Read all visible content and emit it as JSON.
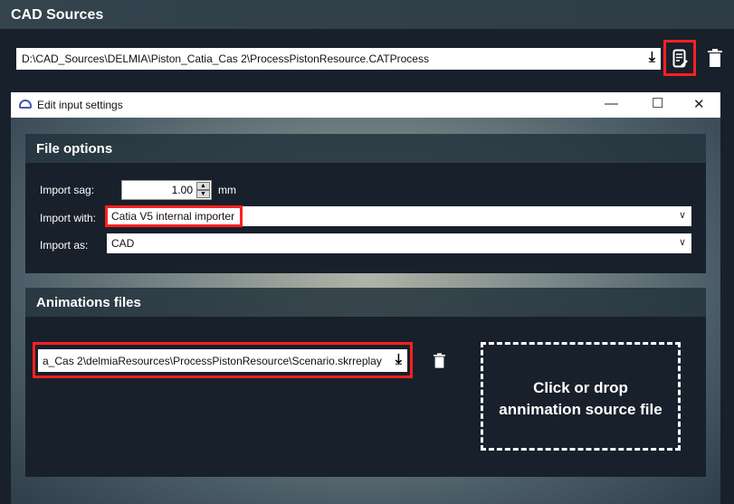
{
  "header": {
    "title": "CAD Sources"
  },
  "source": {
    "path": "D:\\CAD_Sources\\DELMIA\\Piston_Catia_Cas 2\\ProcessPistonResource.CATProcess"
  },
  "dialog": {
    "title": "Edit input settings",
    "file_options": {
      "title": "File options",
      "sag_label": "Import sag:",
      "sag_value": "1.00",
      "sag_unit": "mm",
      "with_label": "Import with:",
      "with_value": "Catia V5 internal importer",
      "as_label": "Import as:",
      "as_value": "CAD"
    },
    "animations": {
      "title": "Animations files",
      "file": "a_Cas 2\\delmiaResources\\ProcessPistonResource\\Scenario.skrreplay",
      "drop_line1": "Click or drop",
      "drop_line2": "annimation source file"
    }
  },
  "colors": {
    "highlight": "#ff2020",
    "background": "#18202b"
  }
}
